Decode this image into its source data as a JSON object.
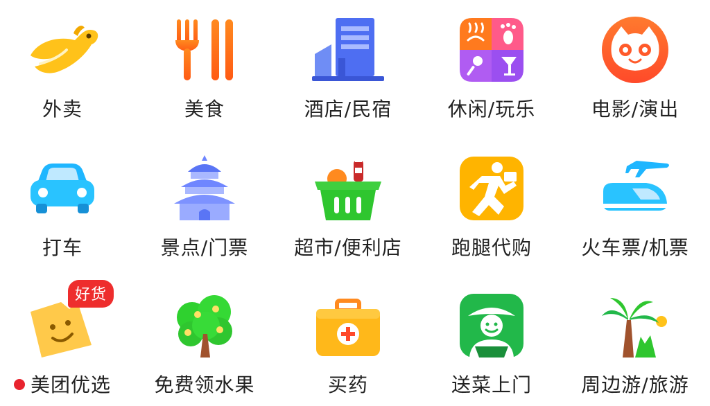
{
  "grid": {
    "items": [
      {
        "label": "外卖",
        "icon": "kangaroo-delivery-icon"
      },
      {
        "label": "美食",
        "icon": "fork-chopsticks-icon"
      },
      {
        "label": "酒店/民宿",
        "icon": "hotel-building-icon"
      },
      {
        "label": "休闲/玩乐",
        "icon": "leisure-grid-icon"
      },
      {
        "label": "电影/演出",
        "icon": "cat-face-icon"
      },
      {
        "label": "打车",
        "icon": "car-icon"
      },
      {
        "label": "景点/门票",
        "icon": "temple-icon"
      },
      {
        "label": "超市/便利店",
        "icon": "shopping-basket-icon"
      },
      {
        "label": "跑腿代购",
        "icon": "runner-icon"
      },
      {
        "label": "火车票/机票",
        "icon": "train-plane-icon"
      },
      {
        "label": "美团优选",
        "icon": "smiley-tag-icon",
        "badge": "好货",
        "has_dot": true
      },
      {
        "label": "免费领水果",
        "icon": "fruit-tree-icon"
      },
      {
        "label": "买药",
        "icon": "medicine-kit-icon"
      },
      {
        "label": "送菜上门",
        "icon": "farmer-icon"
      },
      {
        "label": "周边游/旅游",
        "icon": "palm-tree-icon"
      }
    ]
  },
  "colors": {
    "label_text": "#222222",
    "badge_bg": "#ee2d2d",
    "dot": "#e8242e",
    "brand_yellow": "#ffc21a"
  }
}
